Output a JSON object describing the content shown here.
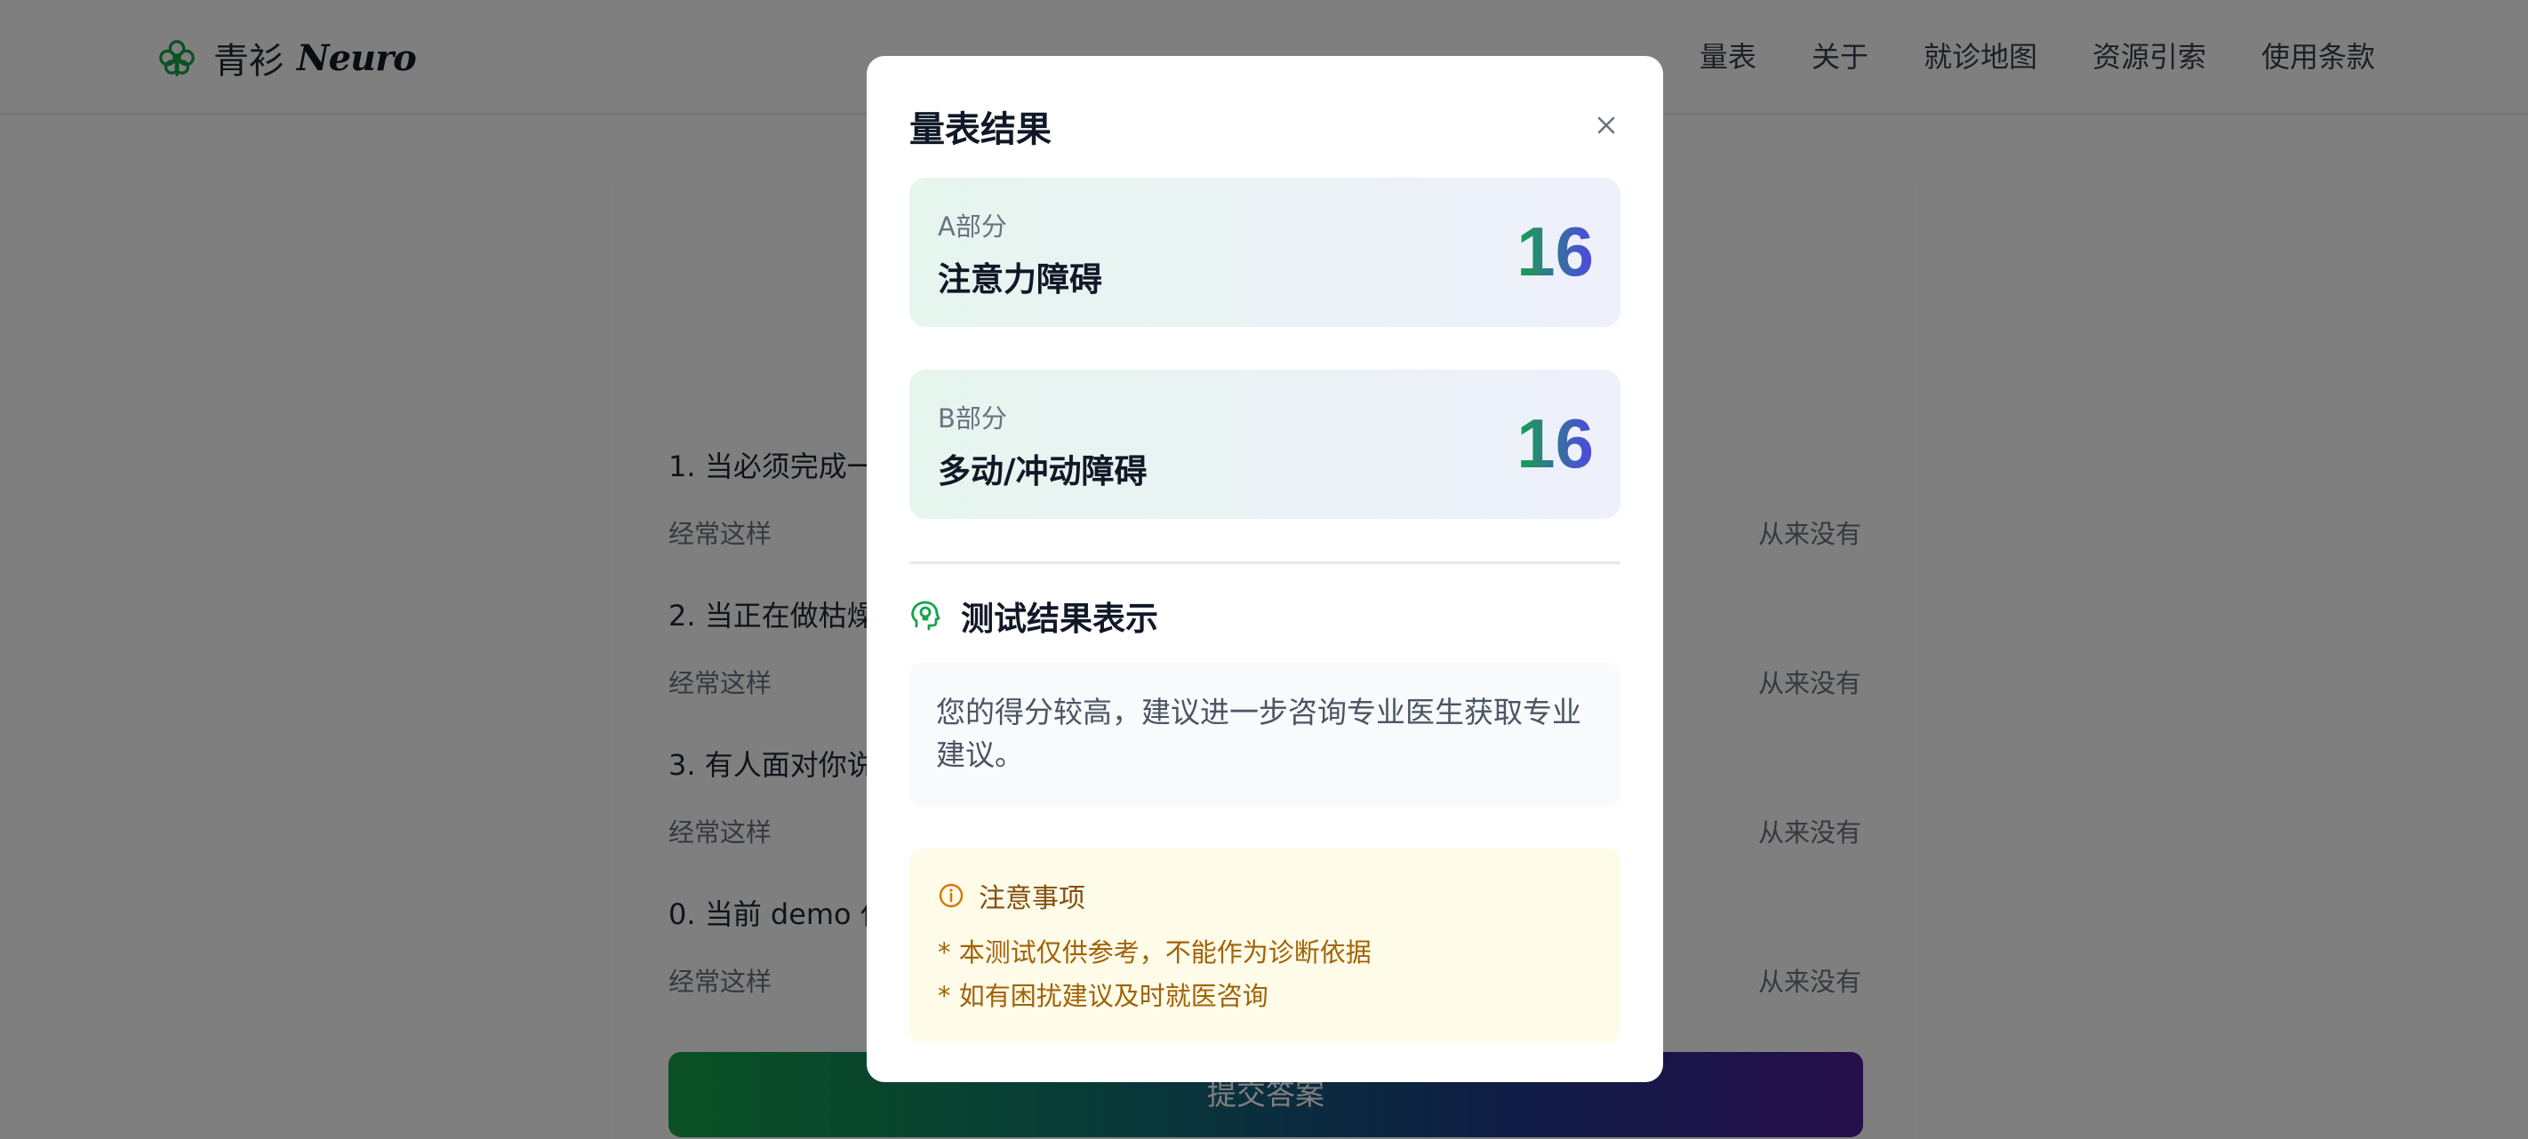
{
  "header": {
    "logo_cn": "青衫",
    "logo_en": "Neuro",
    "nav": [
      "量表",
      "关于",
      "就诊地图",
      "资源引索",
      "使用条款"
    ]
  },
  "form": {
    "questions": [
      {
        "text": "1. 当必须完成一",
        "left_label": "经常这样",
        "right_label": "从来没有"
      },
      {
        "text": "2. 当正在做枯燥",
        "left_label": "经常这样",
        "right_label": "从来没有"
      },
      {
        "text": "3. 有人面对你说",
        "left_label": "经常这样",
        "right_label": "从来没有"
      },
      {
        "text": "0. 当前 demo 仅",
        "left_label": "经常这样",
        "right_label": "从来没有"
      }
    ],
    "submit_label": "提交答案"
  },
  "modal": {
    "title": "量表结果",
    "close_icon": "close-icon",
    "parts": [
      {
        "part": "A部分",
        "name": "注意力障碍",
        "score": "16"
      },
      {
        "part": "B部分",
        "name": "多动/冲动障碍",
        "score": "16"
      }
    ],
    "section_title": "测试结果表示",
    "section_icon": "head-lightbulb-icon",
    "result_text": "您的得分较高，建议进一步咨询专业医生获取专业建议。",
    "notice": {
      "title": "注意事项",
      "icon": "info-icon",
      "items": [
        "* 本测试仅供参考，不能作为诊断依据",
        "* 如有困扰建议及时就医咨询"
      ]
    }
  },
  "colors": {
    "accent_green": "#16a34a",
    "accent_indigo": "#4f46e5",
    "notice_bg": "#fefbe8",
    "notice_text": "#a16207"
  }
}
